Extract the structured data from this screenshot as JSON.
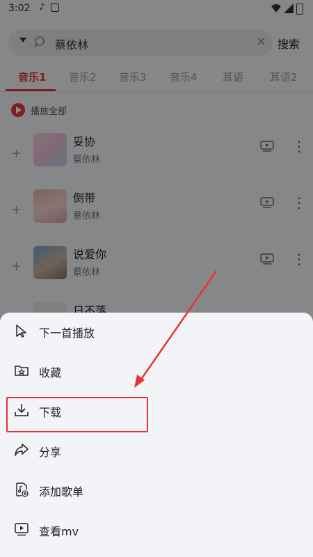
{
  "status_bar": {
    "time": "3:02",
    "note_icon": "music-note-icon"
  },
  "search": {
    "value": "蔡依林",
    "clear": "×",
    "button": "搜索"
  },
  "tabs": [
    {
      "label": "音乐1",
      "active": true
    },
    {
      "label": "音乐2"
    },
    {
      "label": "音乐3"
    },
    {
      "label": "音乐4"
    },
    {
      "label": "耳语"
    },
    {
      "label": "耳语2"
    }
  ],
  "play_all": "播放全部",
  "songs": [
    {
      "title": "妥协",
      "artist": "蔡依林"
    },
    {
      "title": "倒带",
      "artist": "蔡依林"
    },
    {
      "title": "说爱你",
      "artist": "蔡依林"
    },
    {
      "title": "日不落",
      "artist": ""
    }
  ],
  "sheet": {
    "items": [
      {
        "label": "下一首播放",
        "icon": "play-next-icon"
      },
      {
        "label": "收藏",
        "icon": "folder-star-icon"
      },
      {
        "label": "下载",
        "icon": "download-icon"
      },
      {
        "label": "分享",
        "icon": "share-icon"
      },
      {
        "label": "添加歌单",
        "icon": "add-playlist-icon"
      },
      {
        "label": "查看mv",
        "icon": "mv-icon"
      }
    ]
  },
  "colors": {
    "accent": "#e53a3a",
    "annotation": "#e53333"
  }
}
